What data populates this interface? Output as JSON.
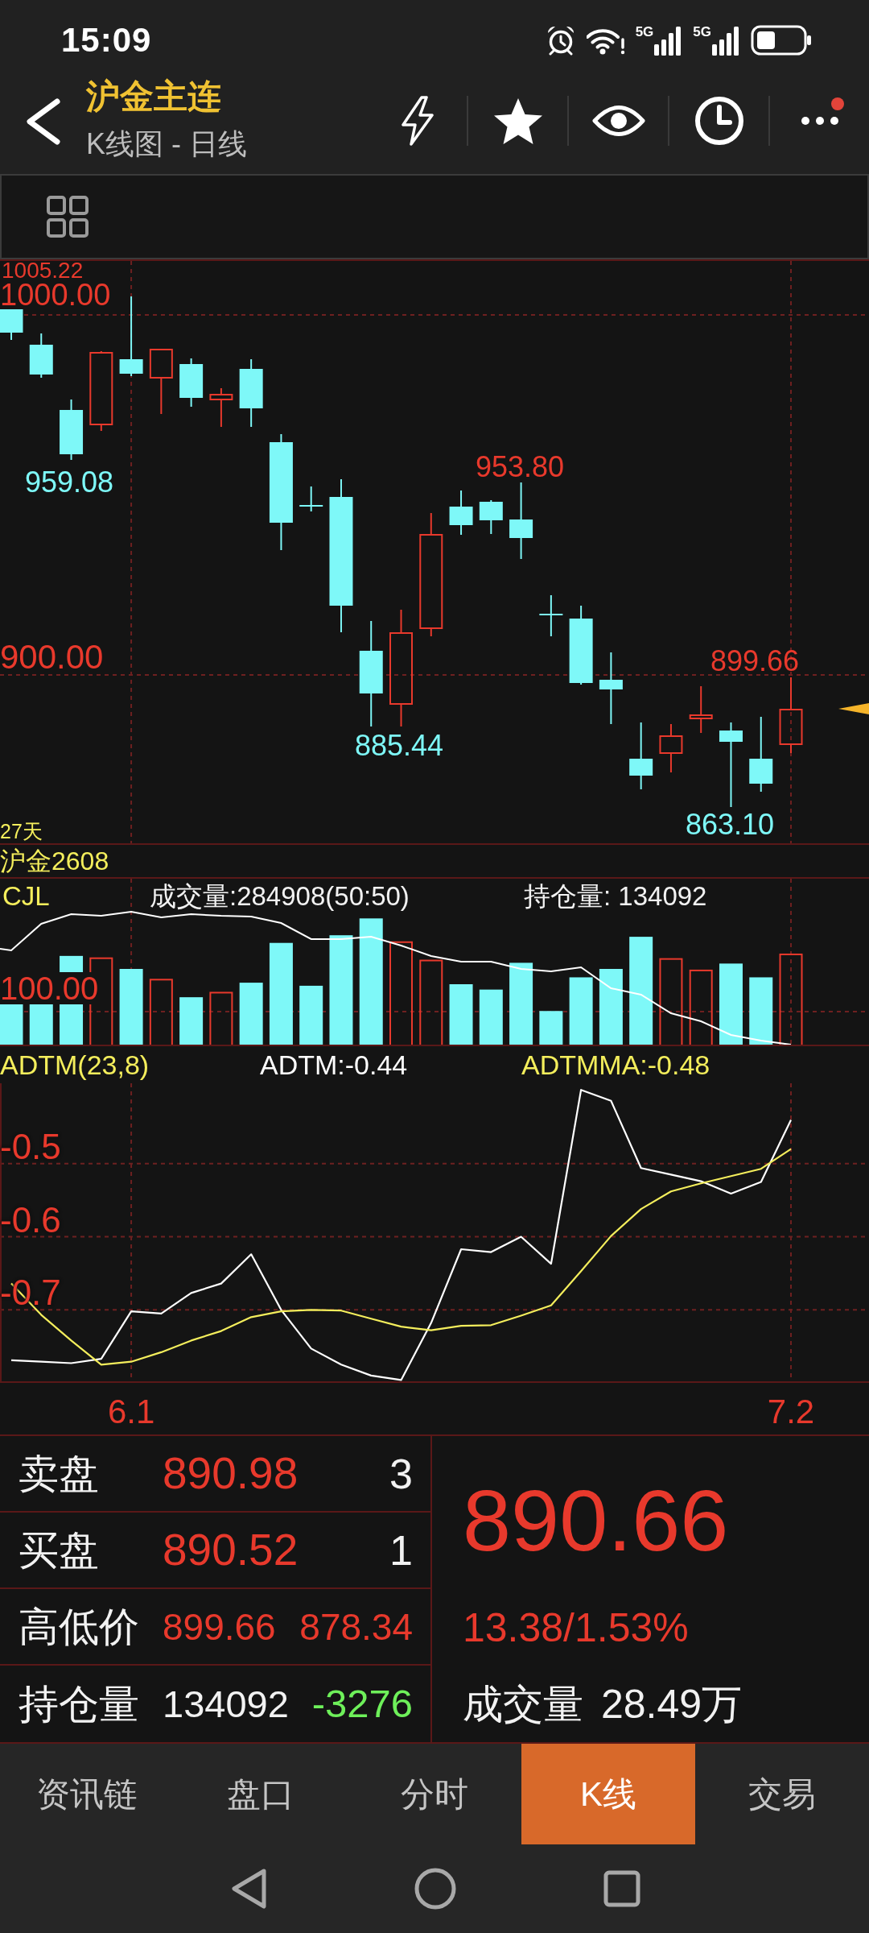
{
  "status_bar": {
    "time": "15:09",
    "network_labels": [
      "5G",
      "5G"
    ]
  },
  "header": {
    "title": "沪金主连",
    "subtitle": "K线图 - 日线",
    "notification_dot": true
  },
  "price_chart": {
    "axis_labels": [
      "1005.22",
      "1000.00",
      "900.00"
    ],
    "price_marks": [
      {
        "text": "959.08",
        "kind": "low"
      },
      {
        "text": "953.80",
        "kind": "high"
      },
      {
        "text": "885.44",
        "kind": "low"
      },
      {
        "text": "899.66",
        "kind": "high"
      },
      {
        "text": "863.10",
        "kind": "low"
      }
    ],
    "days": "27天"
  },
  "contract_strip": {
    "contract": "沪金2608"
  },
  "volume_chart": {
    "label": "CJL",
    "turnover": "成交量:284908(50:50)",
    "open_interest": "持仓量: 134092",
    "axis_label": "100.00"
  },
  "adtm": {
    "title": "ADTM(23,8)",
    "readings": [
      {
        "text": "ADTM:-0.44",
        "color": "#ffffff"
      },
      {
        "text": "ADTMMA:-0.48",
        "color": "#f4ee5c"
      }
    ],
    "chart_data": {
      "type": "line",
      "categories": [
        null,
        null,
        null,
        null,
        "6.1",
        null,
        null,
        null,
        null,
        null,
        null,
        null,
        null,
        null,
        null,
        null,
        null,
        null,
        null,
        null,
        null,
        null,
        null,
        null,
        null,
        null,
        "7.2"
      ],
      "series": [
        {
          "color": "#ffffff",
          "values": [
            -0.769,
            -0.771,
            -0.773,
            -0.767,
            -0.702,
            -0.705,
            -0.677,
            -0.664,
            -0.624,
            -0.7,
            -0.753,
            -0.775,
            -0.79,
            -0.796,
            -0.718,
            -0.617,
            -0.621,
            -0.6,
            -0.637,
            -0.399,
            -0.414,
            -0.506,
            -0.515,
            -0.524,
            -0.541,
            -0.525,
            -0.44
          ]
        },
        {
          "color": "#f4ee5c",
          "values": [
            -0.664,
            -0.707,
            -0.742,
            -0.775,
            -0.771,
            -0.758,
            -0.742,
            -0.729,
            -0.71,
            -0.702,
            -0.7,
            -0.701,
            -0.712,
            -0.723,
            -0.728,
            -0.722,
            -0.721,
            -0.708,
            -0.694,
            -0.647,
            -0.599,
            -0.562,
            -0.538,
            -0.527,
            -0.517,
            -0.507,
            -0.48
          ]
        }
      ],
      "ylim": [
        -0.8,
        -0.39
      ],
      "yticks": [
        -0.5,
        -0.6,
        -0.7
      ],
      "grid": true
    }
  },
  "quote": {
    "rows": [
      {
        "kind": "order",
        "label": "卖盘",
        "price": "890.98",
        "count": "3"
      },
      {
        "kind": "order",
        "label": "买盘",
        "price": "890.52",
        "count": "1"
      },
      {
        "kind": "range",
        "label": "高低价",
        "high": "899.66",
        "low": "878.34"
      },
      {
        "kind": "position",
        "label": "持仓量",
        "value": "134092",
        "change": "-3276"
      }
    ],
    "last_price": "890.66",
    "change": "13.38/1.53%",
    "volume_label": "成交量",
    "volume_value": "28.49万"
  },
  "tabs": [
    {
      "label": "资讯链",
      "selected": false
    },
    {
      "label": "盘口",
      "selected": false
    },
    {
      "label": "分时",
      "selected": false
    },
    {
      "label": "K线",
      "selected": true
    },
    {
      "label": "交易",
      "selected": false
    }
  ]
}
